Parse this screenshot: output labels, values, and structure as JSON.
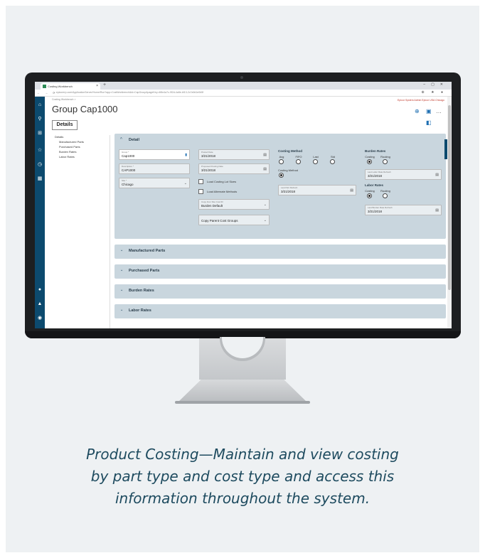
{
  "browser": {
    "tab_title": "Costing Workbench",
    "tab_close": "×",
    "new_tab": "+",
    "window_controls": "–▢✕",
    "nav_buttons": "← → ⟳",
    "url": "epicorerp.com/ApplicationServer/Home/Run?app=CostWorkbench&id=CapGroup&pageKey=4f6e4a7c-9f2d-4a5e-bf13-2c7a9d1e0b5f",
    "extension_icons": "⊕ ★ ●"
  },
  "app": {
    "breadcrumb": "Costing Workbench  >",
    "top_right": "Epicor System Admin  Epicor USA  Chicago",
    "page_title": "Group Cap1000",
    "details_button": "Details",
    "tree": [
      "Details",
      "Manufactured Parts",
      "Purchased Parts",
      "Burden Rates",
      "Labor Rates"
    ],
    "feedback": "Feedback",
    "detail": {
      "header": "Detail",
      "group_label": "Group *",
      "group_value": "Cap1000",
      "description_label": "Description *",
      "description_value": "CAP1000",
      "site_label": "Site *",
      "site_value": "Chicago",
      "posted_date_label": "Posted Date",
      "posted_date_value": "3/21/2018",
      "proposed_posting_label": "Proposed Posting Date",
      "proposed_posting_value": "3/21/2018",
      "load_costing_label": "Load Costing Lot Sizes",
      "load_alternate_label": "Load Alternate Methods",
      "copy_from_label": "Copy from Site Cost ID",
      "copy_from_value": "Burden Default",
      "copy_parent_label": "Copy Parent Cost Groups",
      "costing_method_title": "Costing Method",
      "methods": [
        "Avg",
        "FIFO",
        "Last",
        "Std"
      ],
      "costing_method2": "Costing Method",
      "last_part_refresh_label": "Last Part Refresh",
      "last_part_refresh_value": "3/21/2018",
      "burden_rates_title": "Burden Rates",
      "burden_options": [
        "Costing",
        "Routing"
      ],
      "last_labor_label": "Last Labor Rate Refresh",
      "last_labor_value": "3/21/2018",
      "labor_rates_title": "Labor Rates",
      "labor_options": [
        "Costing",
        "Routing"
      ],
      "last_burden_label": "Last Burden Rate Refresh",
      "last_burden_value": "3/21/2018"
    },
    "sections": [
      "Manufactured Parts",
      "Purchased Parts",
      "Burden Rates",
      "Labor Rates"
    ]
  },
  "caption": {
    "line1": "Product Costing—Maintain and view costing",
    "line2": "by part type and cost type and access this",
    "line3": "information throughout the system."
  },
  "colors": {
    "nav": "#0c4a6e",
    "panel": "#c9d6de",
    "caption": "#1e4b5f",
    "card": "#eef1f3"
  }
}
